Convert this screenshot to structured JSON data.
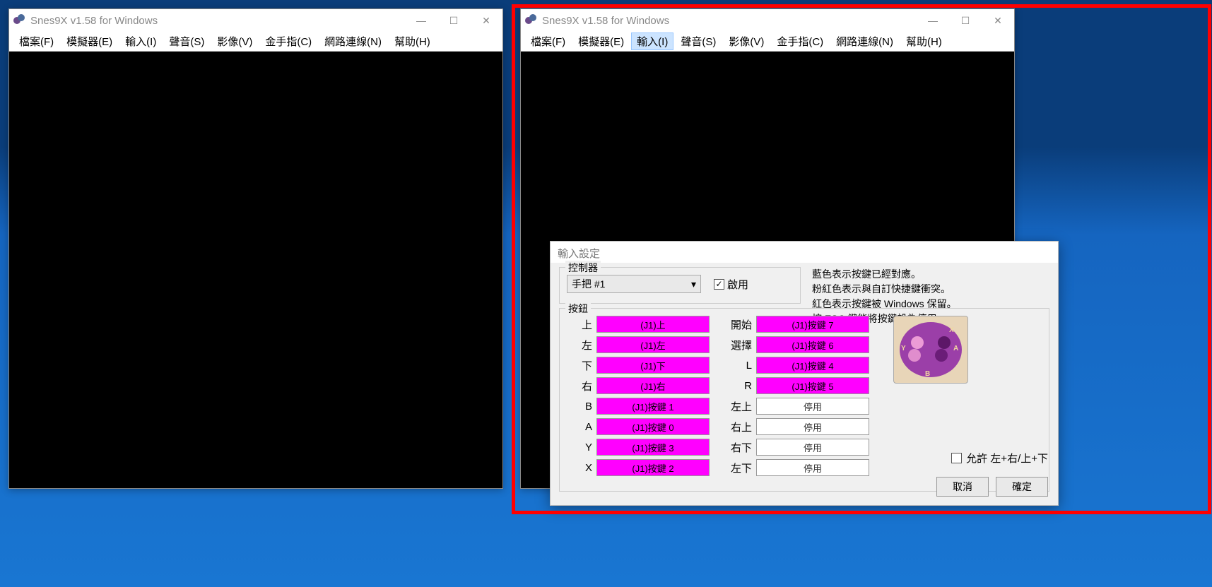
{
  "app_title": "Snes9X v1.58 for Windows",
  "menus": [
    "檔案(F)",
    "模擬器(E)",
    "輸入(I)",
    "聲音(S)",
    "影像(V)",
    "金手指(C)",
    "網路連線(N)",
    "幫助(H)"
  ],
  "active_menu_index_right": 2,
  "dialog": {
    "title": "輸入設定",
    "controller_group": "控制器",
    "controller_select": "手把 #1",
    "enable": "啟用",
    "enable_checked": true,
    "legend": [
      "藍色表示按鍵已經對應。",
      "粉紅色表示與自訂快捷鍵衝突。",
      "紅色表示按鍵被 Windows 保留。",
      "按 ESC 鍵能將按鍵設為停用。"
    ],
    "buttons_group": "按鈕",
    "left_col": [
      {
        "label": "上",
        "value": "(J1)上",
        "pink": true
      },
      {
        "label": "左",
        "value": "(J1)左",
        "pink": true
      },
      {
        "label": "下",
        "value": "(J1)下",
        "pink": true
      },
      {
        "label": "右",
        "value": "(J1)右",
        "pink": true
      },
      {
        "label": "B",
        "value": "(J1)按鍵 1",
        "pink": true
      },
      {
        "label": "A",
        "value": "(J1)按鍵 0",
        "pink": true
      },
      {
        "label": "Y",
        "value": "(J1)按鍵 3",
        "pink": true
      },
      {
        "label": "X",
        "value": "(J1)按鍵 2",
        "pink": true
      }
    ],
    "right_col": [
      {
        "label": "開始",
        "value": "(J1)按鍵 7",
        "pink": true
      },
      {
        "label": "選擇",
        "value": "(J1)按鍵 6",
        "pink": true
      },
      {
        "label": "L",
        "value": "(J1)按鍵 4",
        "pink": true
      },
      {
        "label": "R",
        "value": "(J1)按鍵 5",
        "pink": true
      },
      {
        "label": "左上",
        "value": "停用",
        "pink": false
      },
      {
        "label": "右上",
        "value": "停用",
        "pink": false
      },
      {
        "label": "右下",
        "value": "停用",
        "pink": false
      },
      {
        "label": "左下",
        "value": "停用",
        "pink": false
      }
    ],
    "allow_diag": "允許 左+右/上+下",
    "allow_checked": false,
    "cancel": "取消",
    "ok": "確定"
  }
}
